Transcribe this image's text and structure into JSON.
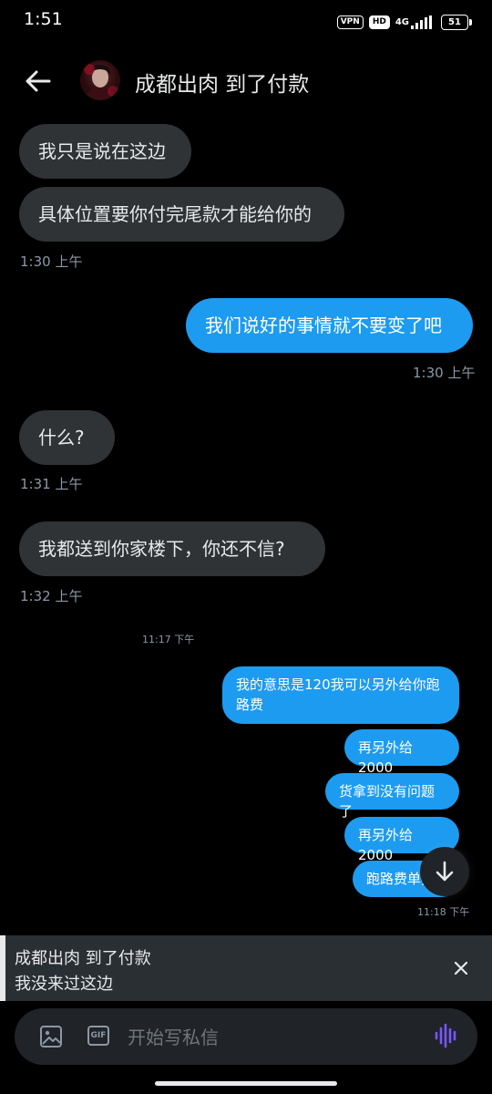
{
  "status_bar": {
    "time": "1:51",
    "vpn": "VPN",
    "hd": "HD",
    "network": "4G",
    "battery": "51"
  },
  "header": {
    "contact_name": "成都出肉 到了付款"
  },
  "messages": [
    {
      "side": "in",
      "text": "我只是说在这边"
    },
    {
      "side": "in",
      "text": "具体位置要你付完尾款才能给你的"
    },
    {
      "time": "1:30 上午"
    },
    {
      "side": "out",
      "text": "我们说好的事情就不要变了吧"
    },
    {
      "time": "1:30 上午"
    },
    {
      "side": "in",
      "text": "什么?"
    },
    {
      "time": "1:31 上午"
    },
    {
      "side": "in",
      "text": "我都送到你家楼下，你还不信?"
    },
    {
      "time": "1:32 上午"
    },
    {
      "time": "11:17 下午"
    },
    {
      "side": "out",
      "text": "我的意思是120我可以另外给你跑路费"
    },
    {
      "side": "out",
      "text": "再另外给2000"
    },
    {
      "side": "out",
      "text": "货拿到没有问题了"
    },
    {
      "side": "out",
      "text": "再另外给2000"
    },
    {
      "side": "out",
      "text": "跑路费单独"
    },
    {
      "time": "11:18 下午"
    }
  ],
  "reply_preview": {
    "name": "成都出肉 到了付款",
    "text": "我没来过这边"
  },
  "composer": {
    "gif_label": "GIF",
    "placeholder": "开始写私信"
  },
  "colors": {
    "background": "#000000",
    "incoming_bubble": "#2f3336",
    "outgoing_bubble": "#1d9bf0",
    "voice_icon": "#7856ff"
  },
  "icons": [
    "back-arrow-icon",
    "image-icon",
    "gif-icon",
    "voice-icon",
    "close-icon",
    "arrow-down-icon"
  ]
}
